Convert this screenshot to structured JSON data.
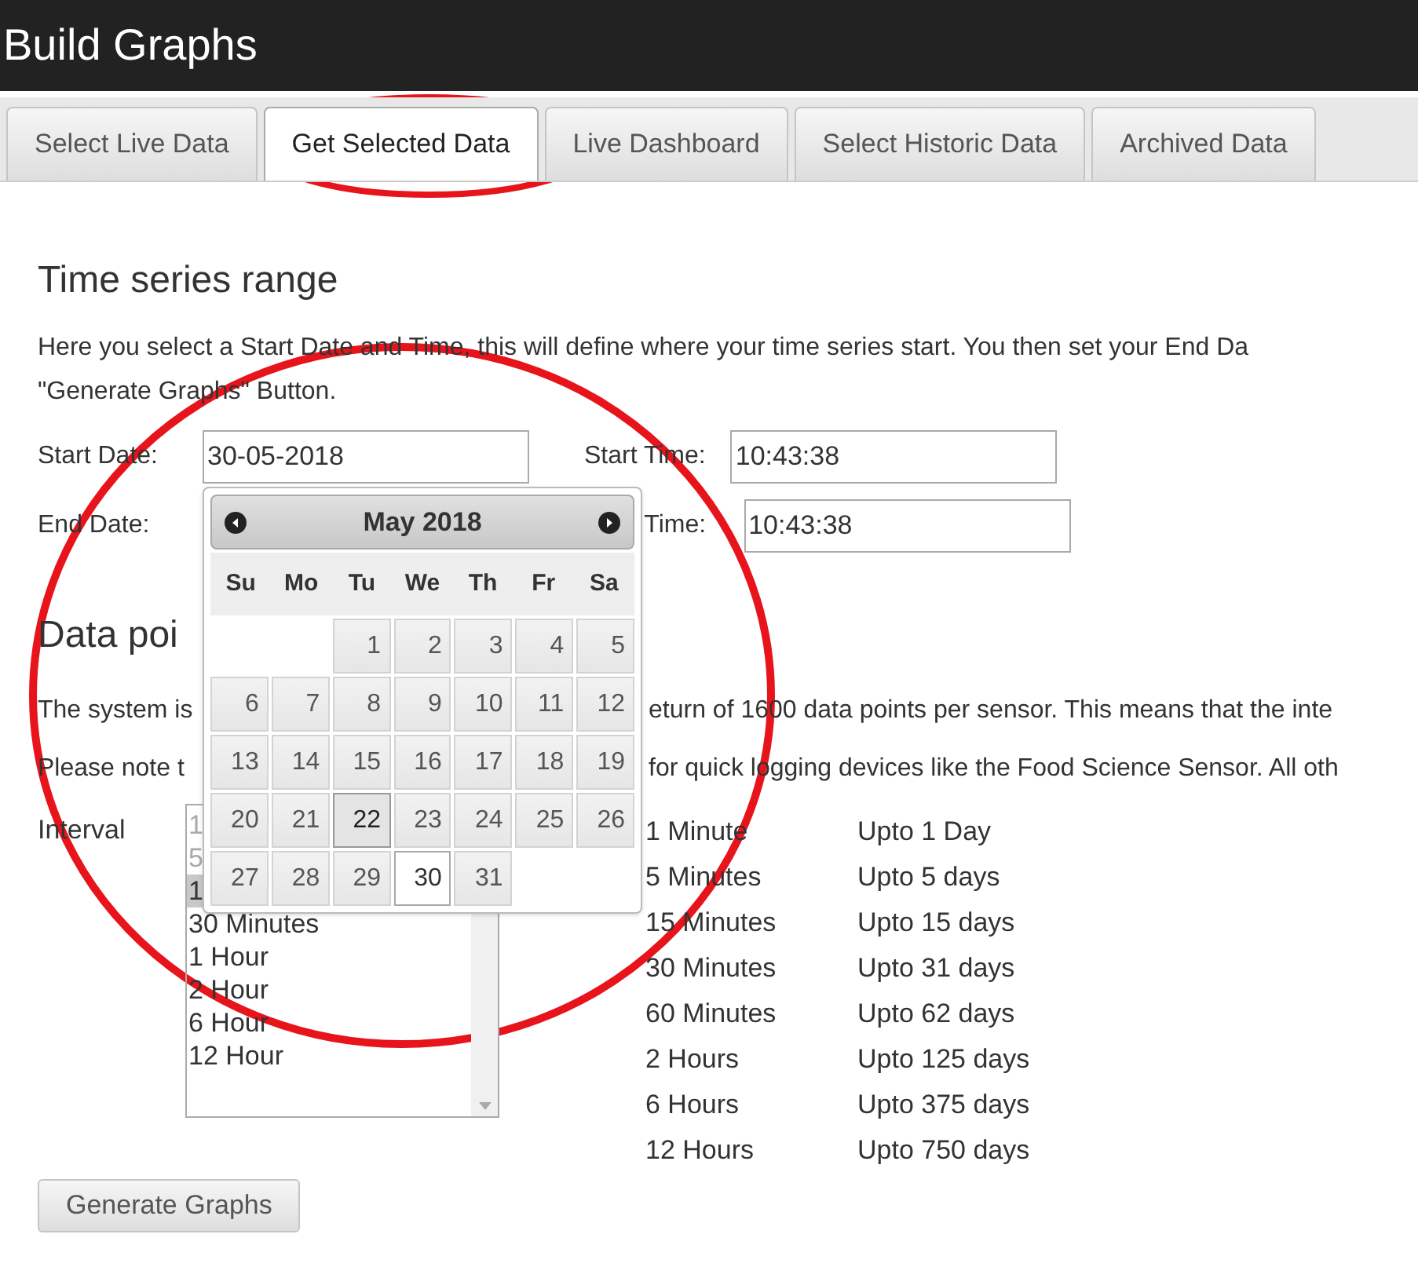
{
  "header": {
    "title": "Build Graphs"
  },
  "tabs": [
    {
      "label": "Select Live Data",
      "selected": false
    },
    {
      "label": "Get Selected Data",
      "selected": true
    },
    {
      "label": "Live Dashboard",
      "selected": false
    },
    {
      "label": "Select Historic Data",
      "selected": false
    },
    {
      "label": "Archived Data",
      "selected": false
    }
  ],
  "range": {
    "heading": "Time series range",
    "intro_lines": [
      "Here you select a Start Date and Time, this will define where your time series start. You then set your End Da",
      "\"Generate Graphs\" Button."
    ],
    "start_date": {
      "label": "Start Date:",
      "value": "30-05-2018"
    },
    "start_time": {
      "label": "Start Time:",
      "value": "10:43:38"
    },
    "end_date": {
      "label": "End Date:"
    },
    "end_time": {
      "label": "Time:",
      "value": "10:43:38"
    }
  },
  "datepicker": {
    "month": "May 2018",
    "weekdays": [
      "Su",
      "Mo",
      "Tu",
      "We",
      "Th",
      "Fr",
      "Sa"
    ],
    "weeks": [
      [
        {
          "day": "1",
          "today": false,
          "selected": false
        },
        {
          "day": "2",
          "today": false,
          "selected": false
        },
        {
          "day": "3",
          "today": false,
          "selected": false
        },
        {
          "day": "4",
          "today": false,
          "selected": false
        },
        {
          "day": "5",
          "today": false,
          "selected": false
        }
      ],
      [
        {
          "day": "6",
          "today": false,
          "selected": false
        },
        {
          "day": "7",
          "today": false,
          "selected": false
        },
        {
          "day": "8",
          "today": false,
          "selected": false
        },
        {
          "day": "9",
          "today": false,
          "selected": false
        },
        {
          "day": "10",
          "today": false,
          "selected": false
        },
        {
          "day": "11",
          "today": false,
          "selected": false
        },
        {
          "day": "12",
          "today": false,
          "selected": false
        }
      ],
      [
        {
          "day": "13",
          "today": false,
          "selected": false
        },
        {
          "day": "14",
          "today": false,
          "selected": false
        },
        {
          "day": "15",
          "today": false,
          "selected": false
        },
        {
          "day": "16",
          "today": false,
          "selected": false
        },
        {
          "day": "17",
          "today": false,
          "selected": false
        },
        {
          "day": "18",
          "today": false,
          "selected": false
        },
        {
          "day": "19",
          "today": false,
          "selected": false
        }
      ],
      [
        {
          "day": "20",
          "today": false,
          "selected": false
        },
        {
          "day": "21",
          "today": false,
          "selected": false
        },
        {
          "day": "22",
          "today": true,
          "selected": false
        },
        {
          "day": "23",
          "today": false,
          "selected": false
        },
        {
          "day": "24",
          "today": false,
          "selected": false
        },
        {
          "day": "25",
          "today": false,
          "selected": false
        },
        {
          "day": "26",
          "today": false,
          "selected": false
        }
      ],
      [
        {
          "day": "27",
          "today": false,
          "selected": false
        },
        {
          "day": "28",
          "today": false,
          "selected": false
        },
        {
          "day": "29",
          "today": false,
          "selected": false
        },
        {
          "day": "30",
          "today": false,
          "selected": true
        },
        {
          "day": "31",
          "today": false,
          "selected": false
        }
      ]
    ]
  },
  "data_points": {
    "heading": "Data poi",
    "lines": [
      {
        "left": "The system is",
        "right": "eturn of 1600 data points per sensor. This means that the inte"
      },
      {
        "left": "Please note t",
        "right": "for quick logging devices like the Food Science Sensor. All oth"
      }
    ],
    "interval_label": "Interval",
    "interval_options": [
      {
        "label": "1",
        "selected": false,
        "disabled": true
      },
      {
        "label": "5",
        "selected": false,
        "disabled": true
      },
      {
        "label": "1",
        "selected": true,
        "disabled": false
      },
      {
        "label": "30 Minutes",
        "selected": false,
        "disabled": false
      },
      {
        "label": "1 Hour",
        "selected": false,
        "disabled": false
      },
      {
        "label": "2 Hour",
        "selected": false,
        "disabled": false
      },
      {
        "label": "6 Hour",
        "selected": false,
        "disabled": false
      },
      {
        "label": "12 Hour",
        "selected": false,
        "disabled": false
      }
    ],
    "limits": [
      {
        "interval": "1 Minute",
        "range": "Upto 1 Day"
      },
      {
        "interval": "5 Minutes",
        "range": "Upto 5 days"
      },
      {
        "interval": "15 Minutes",
        "range": "Upto 15 days"
      },
      {
        "interval": "30 Minutes",
        "range": "Upto 31 days"
      },
      {
        "interval": "60 Minutes",
        "range": "Upto 62 days"
      },
      {
        "interval": "2 Hours",
        "range": "Upto 125 days"
      },
      {
        "interval": "6 Hours",
        "range": "Upto 375 days"
      },
      {
        "interval": "12 Hours",
        "range": "Upto 750 days"
      }
    ]
  },
  "generate_button": "Generate Graphs"
}
